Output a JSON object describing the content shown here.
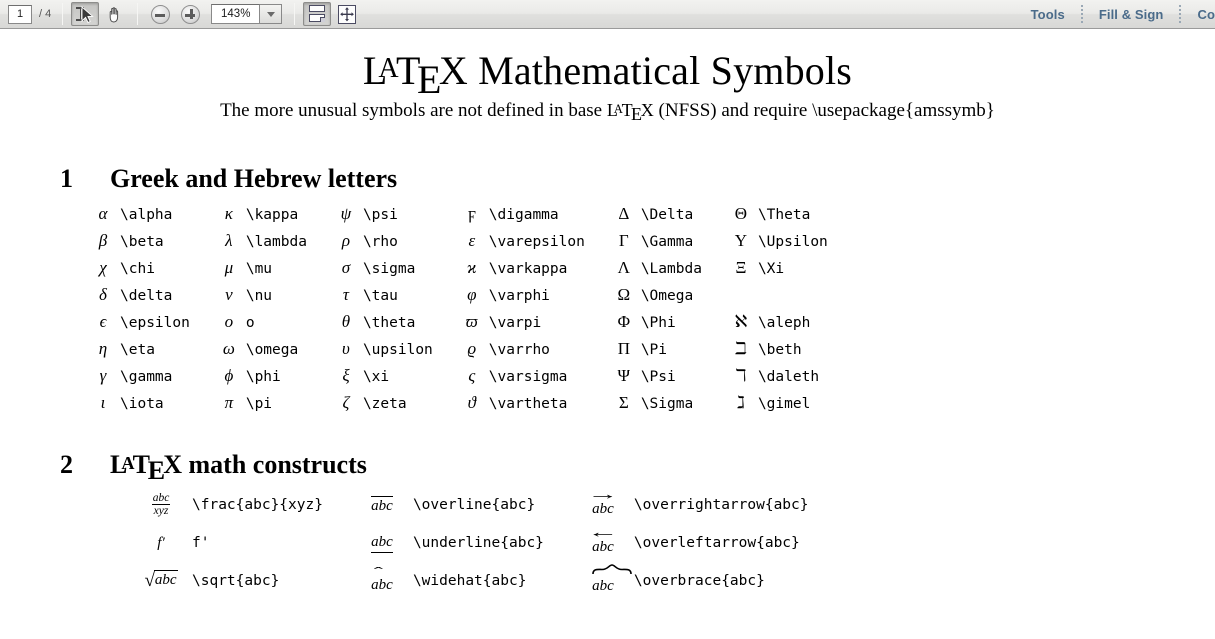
{
  "toolbar": {
    "page_current": "1",
    "page_total": "/ 4",
    "page_placeholder": "1",
    "select_tool": "select-tool",
    "hand_tool": "hand-tool",
    "zoom_out": "zoom-out",
    "zoom_in": "zoom-in",
    "zoom_value": "143%",
    "zoom_options": [
      "143%"
    ],
    "page_view_button": "single-page-view",
    "fit_page_button": "fit-page",
    "right_menus": [
      "Tools",
      "Fill & Sign",
      "Co"
    ]
  },
  "document": {
    "title_pre": "L",
    "title_a": "A",
    "title_t": "T",
    "title_e": "E",
    "title_x": "X",
    "title_rest": "Mathematical Symbols",
    "subtitle_a": "The more unusual symbols are not defined in base ",
    "subtitle_b": " (NFSS) and require \\usepackage{amssymb}",
    "sections": [
      {
        "number": "1",
        "heading": "Greek and Hebrew letters",
        "columns": [
          [
            {
              "sym": "α",
              "cmd": "\\alpha"
            },
            {
              "sym": "β",
              "cmd": "\\beta"
            },
            {
              "sym": "χ",
              "cmd": "\\chi"
            },
            {
              "sym": "δ",
              "cmd": "\\delta"
            },
            {
              "sym": "ϵ",
              "cmd": "\\epsilon"
            },
            {
              "sym": "η",
              "cmd": "\\eta"
            },
            {
              "sym": "γ",
              "cmd": "\\gamma"
            },
            {
              "sym": "ι",
              "cmd": "\\iota"
            }
          ],
          [
            {
              "sym": "κ",
              "cmd": "\\kappa"
            },
            {
              "sym": "λ",
              "cmd": "\\lambda"
            },
            {
              "sym": "μ",
              "cmd": "\\mu"
            },
            {
              "sym": "ν",
              "cmd": "\\nu"
            },
            {
              "sym": "o",
              "cmd": "o"
            },
            {
              "sym": "ω",
              "cmd": "\\omega"
            },
            {
              "sym": "ϕ",
              "cmd": "\\phi"
            },
            {
              "sym": "π",
              "cmd": "\\pi"
            }
          ],
          [
            {
              "sym": "ψ",
              "cmd": "\\psi"
            },
            {
              "sym": "ρ",
              "cmd": "\\rho"
            },
            {
              "sym": "σ",
              "cmd": "\\sigma"
            },
            {
              "sym": "τ",
              "cmd": "\\tau"
            },
            {
              "sym": "θ",
              "cmd": "\\theta"
            },
            {
              "sym": "υ",
              "cmd": "\\upsilon"
            },
            {
              "sym": "ξ",
              "cmd": "\\xi"
            },
            {
              "sym": "ζ",
              "cmd": "\\zeta"
            }
          ],
          [
            {
              "sym": "ϝ",
              "cmd": "\\digamma"
            },
            {
              "sym": "ε",
              "cmd": "\\varepsilon"
            },
            {
              "sym": "ϰ",
              "cmd": "\\varkappa"
            },
            {
              "sym": "φ",
              "cmd": "\\varphi"
            },
            {
              "sym": "ϖ",
              "cmd": "\\varpi"
            },
            {
              "sym": "ϱ",
              "cmd": "\\varrho"
            },
            {
              "sym": "ς",
              "cmd": "\\varsigma"
            },
            {
              "sym": "ϑ",
              "cmd": "\\vartheta"
            }
          ],
          [
            {
              "sym": "Δ",
              "cmd": "\\Delta"
            },
            {
              "sym": "Γ",
              "cmd": "\\Gamma"
            },
            {
              "sym": "Λ",
              "cmd": "\\Lambda"
            },
            {
              "sym": "Ω",
              "cmd": "\\Omega"
            },
            {
              "sym": "Φ",
              "cmd": "\\Phi"
            },
            {
              "sym": "Π",
              "cmd": "\\Pi"
            },
            {
              "sym": "Ψ",
              "cmd": "\\Psi"
            },
            {
              "sym": "Σ",
              "cmd": "\\Sigma"
            }
          ],
          [
            {
              "sym": "Θ",
              "cmd": "\\Theta"
            },
            {
              "sym": "Υ",
              "cmd": "\\Upsilon"
            },
            {
              "sym": "Ξ",
              "cmd": "\\Xi"
            },
            {
              "sym": "",
              "cmd": ""
            },
            {
              "sym": "ℵ",
              "cmd": "\\aleph"
            },
            {
              "sym": "ℶ",
              "cmd": "\\beth"
            },
            {
              "sym": "ℸ",
              "cmd": "\\daleth"
            },
            {
              "sym": "ℷ",
              "cmd": "\\gimel"
            }
          ]
        ]
      },
      {
        "number": "2",
        "heading_pre": "L",
        "heading_rest": "math constructs",
        "constructs": [
          [
            {
              "render": "frac",
              "num": "abc",
              "den": "xyz",
              "cmd": "\\frac{abc}{xyz}"
            },
            {
              "render": "prime",
              "base": "f",
              "cmd": "f'"
            },
            {
              "render": "sqrt",
              "base": "abc",
              "cmd": "\\sqrt{abc}"
            }
          ],
          [
            {
              "render": "overline",
              "base": "abc",
              "cmd": "\\overline{abc}"
            },
            {
              "render": "underline",
              "base": "abc",
              "cmd": "\\underline{abc}"
            },
            {
              "render": "widehat",
              "base": "abc",
              "cmd": "\\widehat{abc}"
            }
          ],
          [
            {
              "render": "overrightarrow",
              "base": "abc",
              "cmd": "\\overrightarrow{abc}"
            },
            {
              "render": "overleftarrow",
              "base": "abc",
              "cmd": "\\overleftarrow{abc}"
            },
            {
              "render": "overbrace",
              "base": "abc",
              "cmd": "\\overbrace{abc}"
            }
          ]
        ]
      }
    ]
  },
  "colors": {
    "toolbar_menu_text": "#4a6b8a",
    "toolbar_bg": "#e8e8e6",
    "page_bg": "#ffffff",
    "text": "#000000"
  }
}
